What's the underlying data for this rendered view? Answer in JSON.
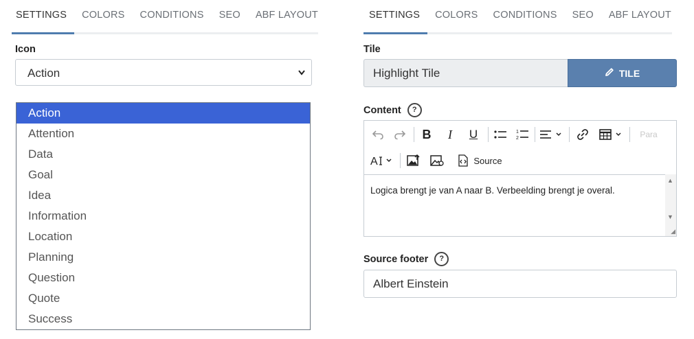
{
  "left": {
    "tabs": [
      "SETTINGS",
      "COLORS",
      "CONDITIONS",
      "SEO",
      "ABF LAYOUT"
    ],
    "icon_label": "Icon",
    "icon_value": "Action",
    "icon_options": [
      "Action",
      "Attention",
      "Data",
      "Goal",
      "Idea",
      "Information",
      "Location",
      "Planning",
      "Question",
      "Quote",
      "Success"
    ]
  },
  "right": {
    "tabs": [
      "SETTINGS",
      "COLORS",
      "CONDITIONS",
      "SEO",
      "ABF LAYOUT"
    ],
    "tile_label": "Tile",
    "tile_value": "Highlight Tile",
    "tile_button": "TILE",
    "content_label": "Content",
    "help_glyph": "?",
    "toolbar": {
      "para_label": "Para",
      "source_label": "Source"
    },
    "content_text": "Logica brengt je van A naar B. Verbeelding brengt je overal.",
    "source_footer_label": "Source footer",
    "source_footer_value": "Albert Einstein"
  },
  "colors": {
    "accent": "#4f7cae",
    "selected_option": "#3a63d6",
    "tile_button_bg": "#5a80ae"
  }
}
